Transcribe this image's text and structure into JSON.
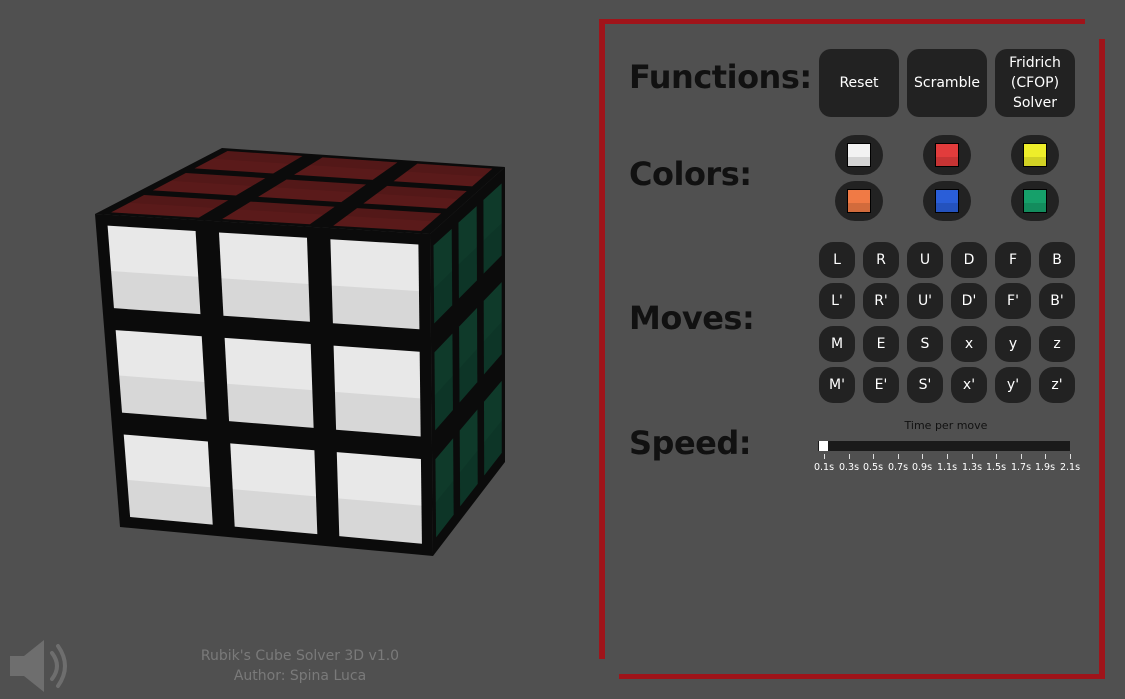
{
  "functions": {
    "title": "Functions:",
    "buttons": [
      {
        "label": "Reset"
      },
      {
        "label": "Scramble"
      },
      {
        "label": "Fridrich\n(CFOP)\nSolver"
      }
    ]
  },
  "colors": {
    "title": "Colors:",
    "swatches": [
      {
        "name": "white",
        "hex": "#f2f2f2"
      },
      {
        "name": "red",
        "hex": "#e23c3c"
      },
      {
        "name": "yellow",
        "hex": "#eeee2a"
      },
      {
        "name": "orange",
        "hex": "#f07a45"
      },
      {
        "name": "blue",
        "hex": "#2a5ed8"
      },
      {
        "name": "green",
        "hex": "#16a06a"
      }
    ]
  },
  "moves": {
    "title": "Moves:",
    "rows": [
      [
        "L",
        "R",
        "U",
        "D",
        "F",
        "B"
      ],
      [
        "L'",
        "R'",
        "U'",
        "D'",
        "F'",
        "B'"
      ],
      [
        "M",
        "E",
        "S",
        "x",
        "y",
        "z"
      ],
      [
        "M'",
        "E'",
        "S'",
        "x'",
        "y'",
        "z'"
      ]
    ]
  },
  "speed": {
    "title": "Speed:",
    "slider_label": "Time per move",
    "value": 0.1,
    "min": 0.1,
    "max": 2.1,
    "ticks": [
      "0.1s",
      "0.3s",
      "0.5s",
      "0.7s",
      "0.9s",
      "1.1s",
      "1.3s",
      "1.5s",
      "1.7s",
      "1.9s",
      "2.1s"
    ]
  },
  "footer": {
    "line1": "Rubik's Cube Solver 3D v1.0",
    "line2": "Author: Spina Luca"
  },
  "cube": {
    "front_color": "#e8e8e8",
    "top_color": "#5a1a1a",
    "right_color": "#0f3a2a"
  },
  "theme": {
    "background": "#505050",
    "frame_color": "#a0141a",
    "button_color": "#222222"
  },
  "icons": {
    "speaker": "speaker-icon"
  }
}
